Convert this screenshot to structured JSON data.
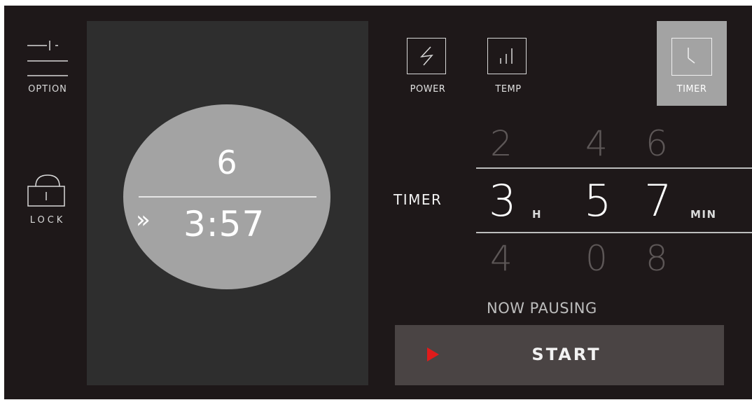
{
  "sidebar": {
    "option_label": "OPTION",
    "lock_label": "LOCK"
  },
  "display": {
    "top_value": "6",
    "arrow_glyph": "»",
    "time": "3:57"
  },
  "modes": {
    "power_label": "POWER",
    "temp_label": "TEMP",
    "timer_label": "TIMER",
    "selected": "TIMER"
  },
  "timer_picker": {
    "label": "TIMER",
    "hours": {
      "above": "2",
      "current": "3",
      "below": "4",
      "unit": "H"
    },
    "minutes_tens": {
      "above": "4",
      "current": "5",
      "below": "0"
    },
    "minutes_ones": {
      "above": "6",
      "current": "7",
      "below": "8"
    },
    "minutes_unit": "MIN"
  },
  "status": "NOW PAUSING",
  "start_button": {
    "label": "START",
    "accent_color": "#e01b1b"
  },
  "icons": {
    "option": "slider-settings-icon",
    "lock": "padlock-icon",
    "power": "lightning-bolt-icon",
    "temp": "bar-levels-icon",
    "timer": "clock-icon",
    "start": "play-icon"
  }
}
